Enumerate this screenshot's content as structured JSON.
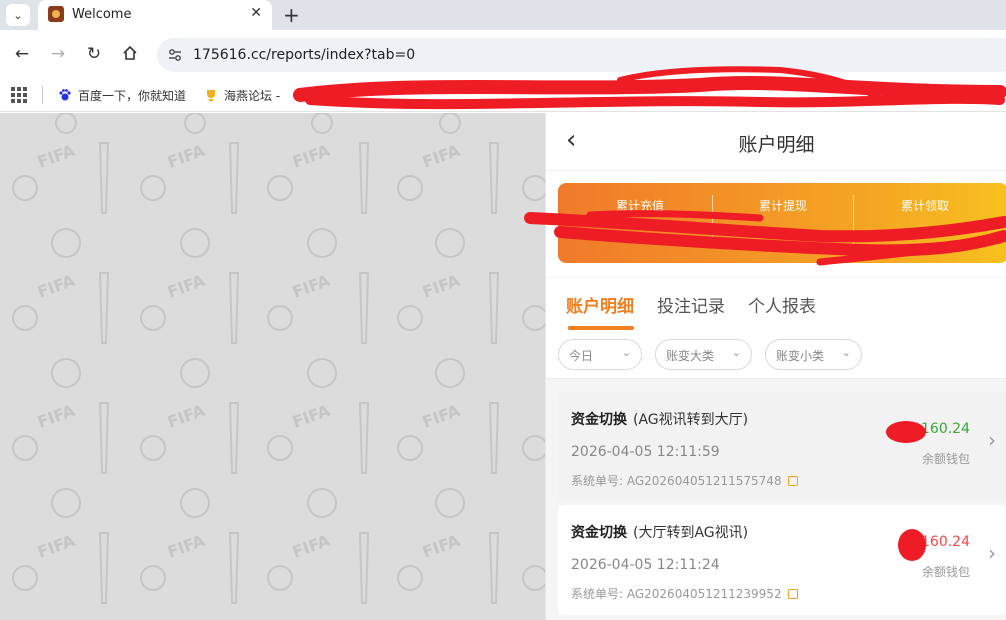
{
  "browser": {
    "tab_title": "Welcome",
    "url": "175616.cc/reports/index?tab=0",
    "bookmarks": [
      {
        "label": "百度一下，你就知道"
      },
      {
        "label": "海燕论坛 -"
      }
    ]
  },
  "panel": {
    "title": "账户明细",
    "summary": [
      {
        "label": "累计充值"
      },
      {
        "label": "累计提现"
      },
      {
        "label": "累计领取"
      }
    ],
    "tabs": [
      {
        "label": "账户明细",
        "active": true
      },
      {
        "label": "投注记录",
        "active": false
      },
      {
        "label": "个人报表",
        "active": false
      }
    ],
    "filters": [
      {
        "label": "今日"
      },
      {
        "label": "账变大类"
      },
      {
        "label": "账变小类"
      }
    ],
    "records": [
      {
        "title": "资金切换",
        "subtitle": "(AG视讯转到大厅)",
        "time": "2026-04-05 12:11:59",
        "id_label": "系统单号: AG202604051211575748",
        "amount": "160.24",
        "wallet": "余额钱包"
      },
      {
        "title": "资金切换",
        "subtitle": "(大厅转到AG视讯)",
        "time": "2026-04-05 12:11:24",
        "id_label": "系统单号: AG202604051211239952",
        "amount": "160.24",
        "wallet": "余额钱包"
      }
    ]
  },
  "icons": {
    "tab_menu": "chevron-down-icon",
    "back": "back-arrow-icon",
    "forward": "forward-arrow-icon",
    "reload": "reload-icon",
    "home": "home-icon",
    "site_info": "site-settings-icon",
    "apps": "apps-grid-icon",
    "copy": "copy-icon",
    "record_arrow": "chevron-right-icon"
  },
  "colors": {
    "accent": "#f07f20",
    "positive_amount": "#3aa63a",
    "negative_amount": "#f04a4a",
    "redaction": "#ee1c25"
  }
}
